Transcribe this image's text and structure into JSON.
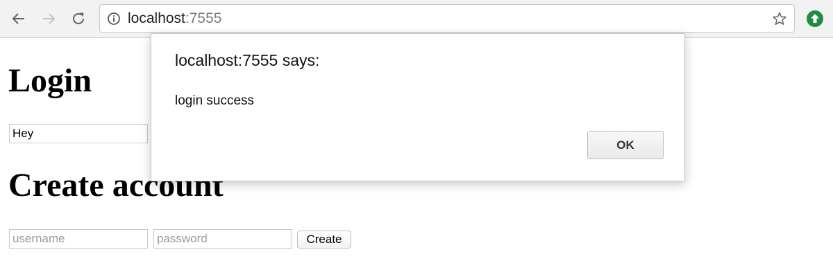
{
  "browser": {
    "url_host": "localhost",
    "url_port": ":7555",
    "icons": {
      "back": "back-arrow-icon",
      "forward": "forward-arrow-icon",
      "reload": "reload-icon",
      "info": "info-icon",
      "bookmark": "star-icon",
      "extension": "extension-upload-icon"
    },
    "colors": {
      "extension": "#1e8e3e",
      "port": "#7a7a7a"
    }
  },
  "page": {
    "login_heading": "Login",
    "login_field_value": "Hey",
    "create_heading": "Create account",
    "username_placeholder": "username",
    "password_placeholder": "password",
    "create_button_label": "Create"
  },
  "dialog": {
    "title": "localhost:7555 says:",
    "message": "login success",
    "ok_label": "OK"
  }
}
